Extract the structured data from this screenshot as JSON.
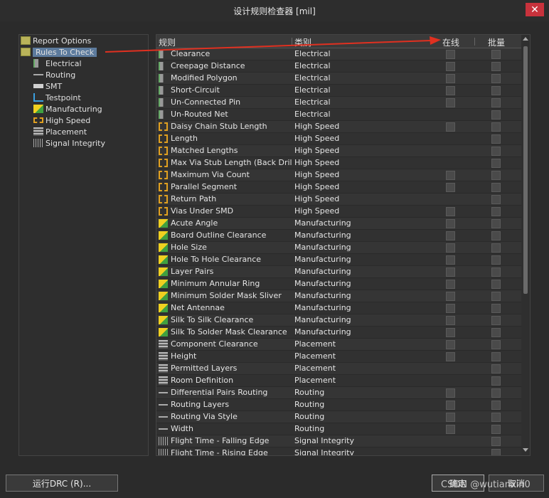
{
  "window": {
    "title": "设计规则检查器 [mil]",
    "close_glyph": "✕"
  },
  "tree": {
    "items": [
      {
        "label": "Report Options",
        "icon": "folder-check-icon",
        "level": 0,
        "selected": false
      },
      {
        "label": "Rules To Check",
        "icon": "folder-check-icon",
        "level": 0,
        "selected": true
      },
      {
        "label": "Electrical",
        "icon": "electrical-icon",
        "level": 1,
        "selected": false
      },
      {
        "label": "Routing",
        "icon": "routing-icon",
        "level": 1,
        "selected": false
      },
      {
        "label": "SMT",
        "icon": "smt-icon",
        "level": 1,
        "selected": false
      },
      {
        "label": "Testpoint",
        "icon": "testpoint-icon",
        "level": 1,
        "selected": false
      },
      {
        "label": "Manufacturing",
        "icon": "manufacturing-icon",
        "level": 1,
        "selected": false
      },
      {
        "label": "High Speed",
        "icon": "high-speed-icon",
        "level": 1,
        "selected": false
      },
      {
        "label": "Placement",
        "icon": "placement-icon",
        "level": 1,
        "selected": false
      },
      {
        "label": "Signal Integrity",
        "icon": "signal-integrity-icon",
        "level": 1,
        "selected": false
      }
    ]
  },
  "grid": {
    "headers": {
      "rule": "规则",
      "category": "类别",
      "online": "在线",
      "batch": "批量"
    },
    "rows": [
      {
        "name": "Clearance",
        "category": "Electrical",
        "online": true,
        "batch": true
      },
      {
        "name": "Creepage Distance",
        "category": "Electrical",
        "online": true,
        "batch": true
      },
      {
        "name": "Modified Polygon",
        "category": "Electrical",
        "online": true,
        "batch": true
      },
      {
        "name": "Short-Circuit",
        "category": "Electrical",
        "online": true,
        "batch": true
      },
      {
        "name": "Un-Connected Pin",
        "category": "Electrical",
        "online": true,
        "batch": true
      },
      {
        "name": "Un-Routed Net",
        "category": "Electrical",
        "online": false,
        "batch": true
      },
      {
        "name": "Daisy Chain Stub Length",
        "category": "High Speed",
        "online": true,
        "batch": true
      },
      {
        "name": "Length",
        "category": "High Speed",
        "online": false,
        "batch": true
      },
      {
        "name": "Matched Lengths",
        "category": "High Speed",
        "online": false,
        "batch": true
      },
      {
        "name": "Max Via Stub Length (Back Drilling)",
        "category": "High Speed",
        "online": false,
        "batch": true
      },
      {
        "name": "Maximum Via Count",
        "category": "High Speed",
        "online": true,
        "batch": true
      },
      {
        "name": "Parallel Segment",
        "category": "High Speed",
        "online": true,
        "batch": true
      },
      {
        "name": "Return Path",
        "category": "High Speed",
        "online": false,
        "batch": true
      },
      {
        "name": "Vias Under SMD",
        "category": "High Speed",
        "online": true,
        "batch": true
      },
      {
        "name": "Acute Angle",
        "category": "Manufacturing",
        "online": true,
        "batch": true
      },
      {
        "name": "Board Outline Clearance",
        "category": "Manufacturing",
        "online": true,
        "batch": true
      },
      {
        "name": "Hole Size",
        "category": "Manufacturing",
        "online": true,
        "batch": true
      },
      {
        "name": "Hole To Hole Clearance",
        "category": "Manufacturing",
        "online": true,
        "batch": true
      },
      {
        "name": "Layer Pairs",
        "category": "Manufacturing",
        "online": true,
        "batch": true
      },
      {
        "name": "Minimum Annular Ring",
        "category": "Manufacturing",
        "online": true,
        "batch": true
      },
      {
        "name": "Minimum Solder Mask Sliver",
        "category": "Manufacturing",
        "online": true,
        "batch": true
      },
      {
        "name": "Net Antennae",
        "category": "Manufacturing",
        "online": true,
        "batch": true
      },
      {
        "name": "Silk To Silk Clearance",
        "category": "Manufacturing",
        "online": true,
        "batch": true
      },
      {
        "name": "Silk To Solder Mask Clearance",
        "category": "Manufacturing",
        "online": true,
        "batch": true
      },
      {
        "name": "Component Clearance",
        "category": "Placement",
        "online": true,
        "batch": true
      },
      {
        "name": "Height",
        "category": "Placement",
        "online": true,
        "batch": true
      },
      {
        "name": "Permitted Layers",
        "category": "Placement",
        "online": false,
        "batch": true
      },
      {
        "name": "Room Definition",
        "category": "Placement",
        "online": false,
        "batch": true
      },
      {
        "name": "Differential Pairs Routing",
        "category": "Routing",
        "online": true,
        "batch": true
      },
      {
        "name": "Routing Layers",
        "category": "Routing",
        "online": true,
        "batch": true
      },
      {
        "name": "Routing Via Style",
        "category": "Routing",
        "online": true,
        "batch": true
      },
      {
        "name": "Width",
        "category": "Routing",
        "online": true,
        "batch": true
      },
      {
        "name": "Flight Time - Falling Edge",
        "category": "Signal Integrity",
        "online": false,
        "batch": true
      },
      {
        "name": "Flight Time - Rising Edge",
        "category": "Signal Integrity",
        "online": false,
        "batch": true
      }
    ]
  },
  "buttons": {
    "run_drc": "运行DRC (R)...",
    "ok": "确定",
    "cancel": "取消"
  },
  "watermark": "CSDN @wutianxin0",
  "colors": {
    "background": "#2b2b2b",
    "selection": "#5d7b9d",
    "annotation_arrow": "#e03020",
    "close_button": "#c8323c"
  }
}
